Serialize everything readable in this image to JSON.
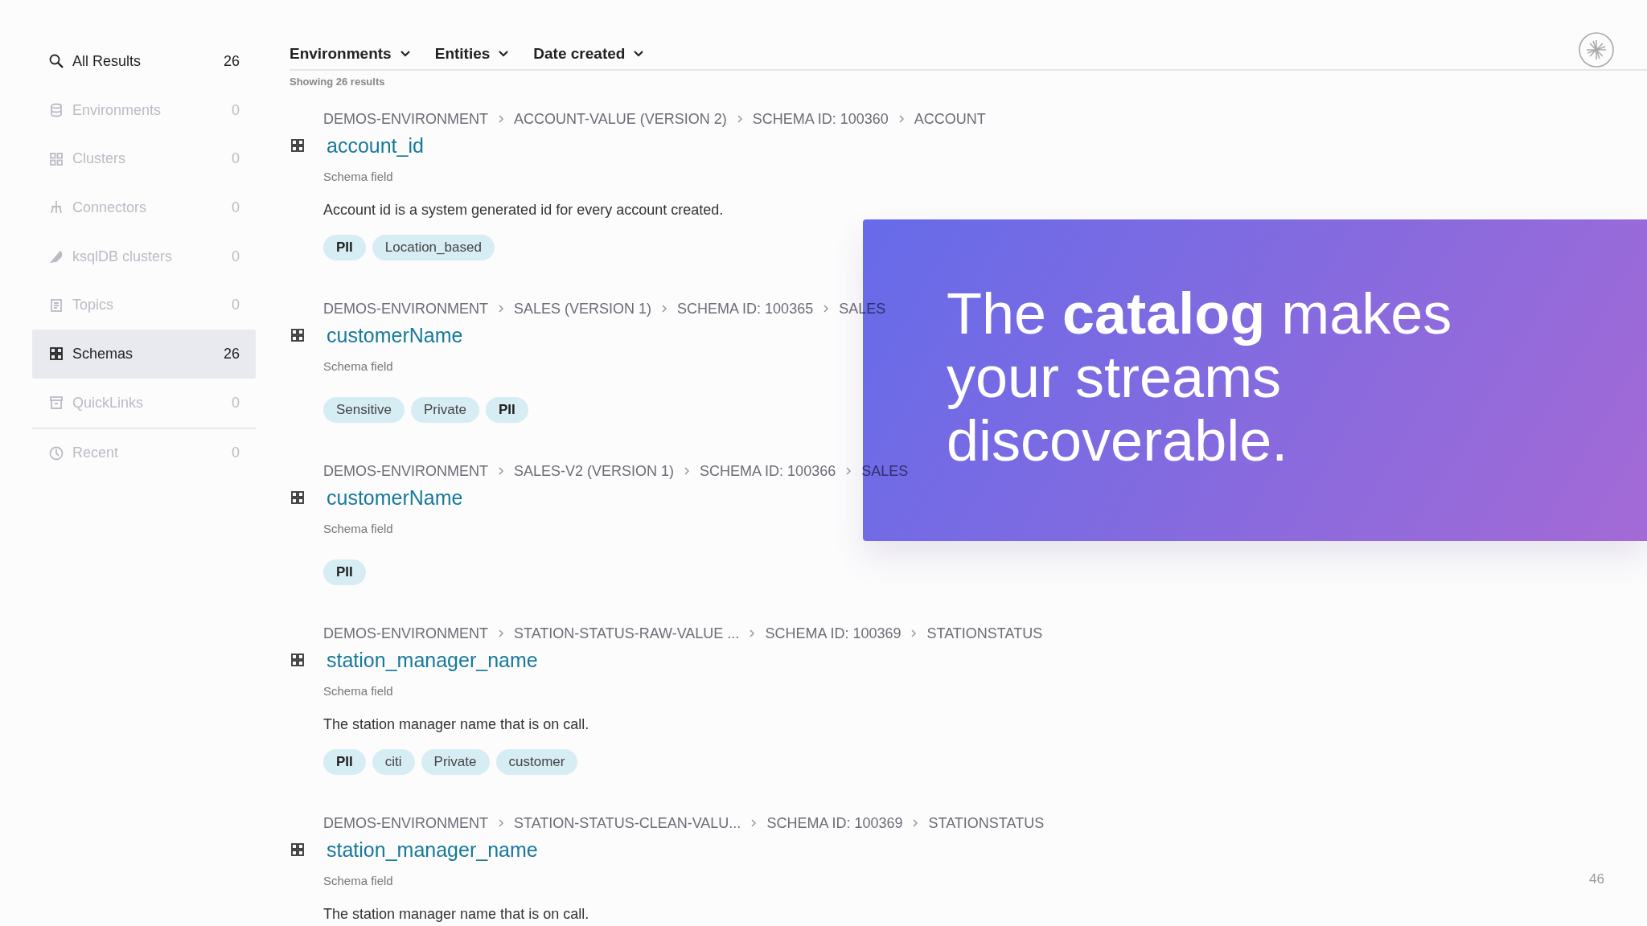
{
  "sidebar": {
    "items": [
      {
        "label": "All Results",
        "count": "26",
        "disabled": false,
        "selected": false
      },
      {
        "label": "Environments",
        "count": "0",
        "disabled": true,
        "selected": false
      },
      {
        "label": "Clusters",
        "count": "0",
        "disabled": true,
        "selected": false
      },
      {
        "label": "Connectors",
        "count": "0",
        "disabled": true,
        "selected": false
      },
      {
        "label": "ksqlDB clusters",
        "count": "0",
        "disabled": true,
        "selected": false
      },
      {
        "label": "Topics",
        "count": "0",
        "disabled": true,
        "selected": false
      },
      {
        "label": "Schemas",
        "count": "26",
        "disabled": false,
        "selected": true
      },
      {
        "label": "QuickLinks",
        "count": "0",
        "disabled": true,
        "selected": false
      }
    ],
    "recent": {
      "label": "Recent",
      "count": "0",
      "disabled": true
    }
  },
  "filters": [
    "Environments",
    "Entities",
    "Date created"
  ],
  "result_count": "Showing 26 results",
  "results": [
    {
      "path": [
        "DEMOS-ENVIRONMENT",
        "ACCOUNT-VALUE (VERSION 2)",
        "SCHEMA ID: 100360",
        "ACCOUNT"
      ],
      "title": "account_id",
      "type": "Schema field",
      "description": "Account id is a system generated id for every account created.",
      "tags": [
        {
          "label": "PII",
          "kind": "pii"
        },
        {
          "label": "Location_based",
          "kind": "tag"
        }
      ]
    },
    {
      "path": [
        "DEMOS-ENVIRONMENT",
        "SALES (VERSION 1)",
        "SCHEMA ID: 100365",
        "SALES"
      ],
      "title": "customerName",
      "type": "Schema field",
      "tags": [
        {
          "label": "Sensitive",
          "kind": "tag"
        },
        {
          "label": "Private",
          "kind": "tag"
        },
        {
          "label": "PII",
          "kind": "pii"
        }
      ]
    },
    {
      "path": [
        "DEMOS-ENVIRONMENT",
        "SALES-V2 (VERSION 1)",
        "SCHEMA ID: 100366",
        "SALES"
      ],
      "title": "customerName",
      "type": "Schema field",
      "tags": [
        {
          "label": "PII",
          "kind": "pii"
        }
      ]
    },
    {
      "path": [
        "DEMOS-ENVIRONMENT",
        "STATION-STATUS-RAW-VALUE ...",
        "SCHEMA ID: 100369",
        "STATIONSTATUS"
      ],
      "title": "station_manager_name",
      "type": "Schema field",
      "description": "The station manager name that is on call.",
      "tags": [
        {
          "label": "PII",
          "kind": "pii"
        },
        {
          "label": "citi",
          "kind": "tag"
        },
        {
          "label": "Private",
          "kind": "tag"
        },
        {
          "label": "customer",
          "kind": "tag"
        }
      ]
    },
    {
      "path": [
        "DEMOS-ENVIRONMENT",
        "STATION-STATUS-CLEAN-VALU...",
        "SCHEMA ID: 100369",
        "STATIONSTATUS"
      ],
      "title": "station_manager_name",
      "type": "Schema field",
      "description": "The station manager name that is on call."
    }
  ],
  "callout": {
    "text": "The **catalog** makes your streams discoverable."
  },
  "slide_number": "46"
}
